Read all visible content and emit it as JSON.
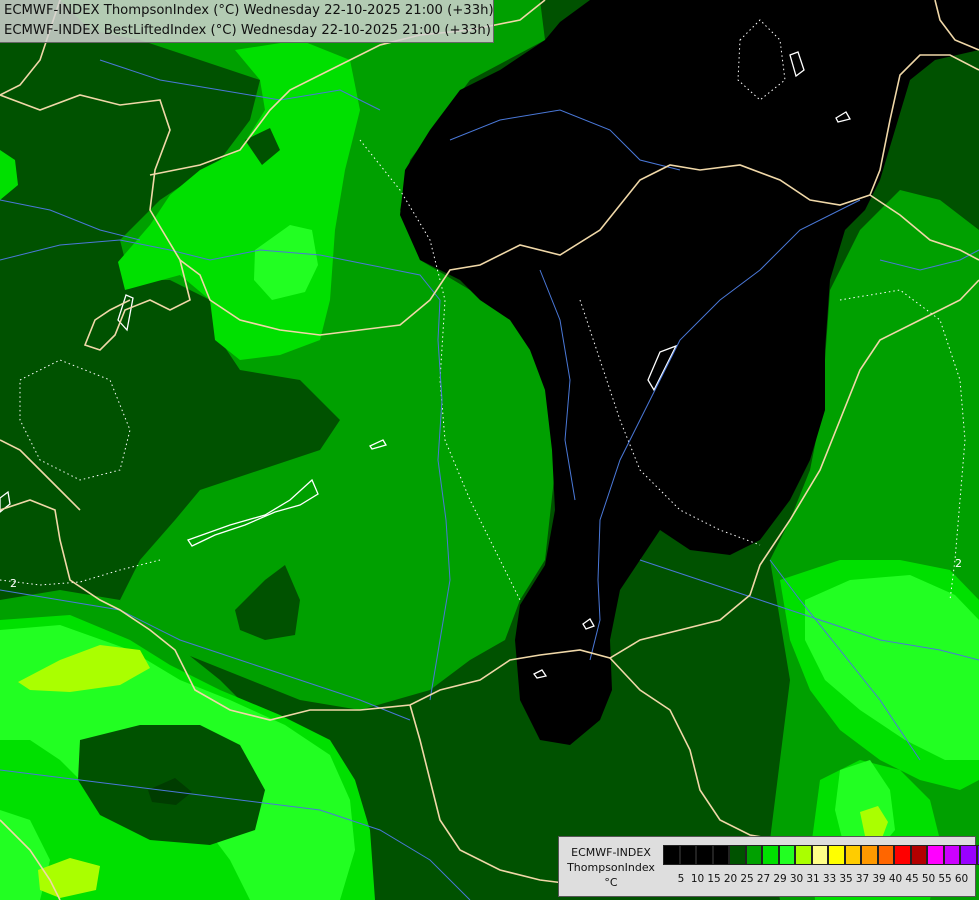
{
  "header": {
    "line1": "ECMWF-INDEX ThompsonIndex (°C) Wednesday 22-10-2025 21:00 (+33h)",
    "line2": "ECMWF-INDEX BestLiftedIndex (°C) Wednesday 22-10-2025 21:00 (+33h)"
  },
  "map": {
    "contour_labels": [
      "2",
      "2"
    ],
    "colors": {
      "black": "#000000",
      "dark_green": "#005200",
      "green": "#00a000",
      "bright_green": "#00e000",
      "lime": "#22ff22",
      "yellow_green": "#aaff00",
      "border_line": "#f0d8a8",
      "river_line": "#4a78d8",
      "contour_line": "#ffffff"
    }
  },
  "legend": {
    "name_line1": "ECMWF-INDEX",
    "name_line2": "ThompsonIndex",
    "unit": "°C",
    "colors": [
      "#000000",
      "#000000",
      "#000000",
      "#000000",
      "#005200",
      "#00a000",
      "#00e000",
      "#22ff22",
      "#aaff00",
      "#ffff88",
      "#ffff00",
      "#ffcc00",
      "#ff9900",
      "#ff6600",
      "#ff0000",
      "#b30000",
      "#ff00ff",
      "#cc00ff",
      "#9900ff",
      "#6600ff",
      "#0000ff"
    ],
    "ticks": [
      "5",
      "10",
      "15",
      "20",
      "25",
      "27",
      "29",
      "30",
      "31",
      "33",
      "35",
      "37",
      "39",
      "40",
      "45",
      "50",
      "55",
      "60"
    ]
  }
}
